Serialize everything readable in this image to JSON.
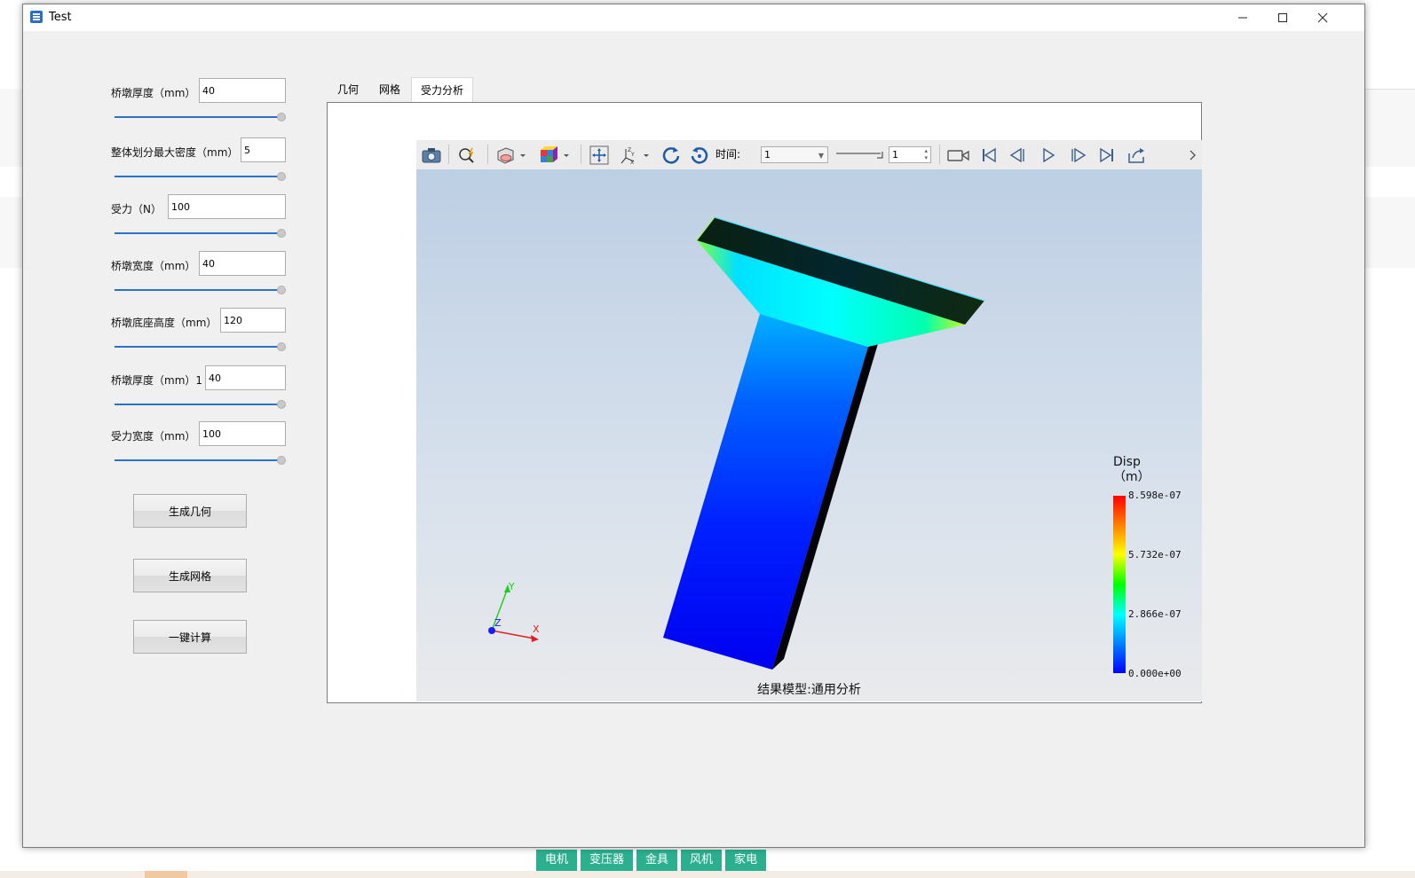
{
  "window": {
    "title": "Test"
  },
  "params": [
    {
      "label": "桥墩厚度（mm）",
      "value": "40"
    },
    {
      "label": "整体划分最大密度（mm）",
      "value": "5"
    },
    {
      "label": "受力（N）",
      "value": "100"
    },
    {
      "label": "桥墩宽度（mm）",
      "value": "40"
    },
    {
      "label": "桥墩底座高度（mm）",
      "value": "120"
    },
    {
      "label": "桥墩厚度（mm）1",
      "value": "40"
    },
    {
      "label": "受力宽度（mm）",
      "value": "100"
    }
  ],
  "buttons": {
    "geometry": "生成几何",
    "mesh": "生成网格",
    "compute": "一键计算"
  },
  "tabs": [
    {
      "label": "几何"
    },
    {
      "label": "网格"
    },
    {
      "label": "受力分析",
      "active": true
    }
  ],
  "toolbar": {
    "time_label": "时间:",
    "time_value": "1",
    "step_value": "1"
  },
  "viewport": {
    "caption": "结果模型:通用分析",
    "axes": {
      "x": "X",
      "y": "Y",
      "z": "Z"
    },
    "legend": {
      "title_line1": "Disp",
      "title_line2": "（m）",
      "ticks": [
        "8.598e-07",
        "5.732e-07",
        "2.866e-07",
        "0.000e+00"
      ]
    }
  },
  "taskbar_tags": [
    "电机",
    "变压器",
    "金具",
    "风机",
    "家电"
  ],
  "colors": {
    "slider_track": "#2a72c8",
    "tag_green": "#2bb08f"
  }
}
